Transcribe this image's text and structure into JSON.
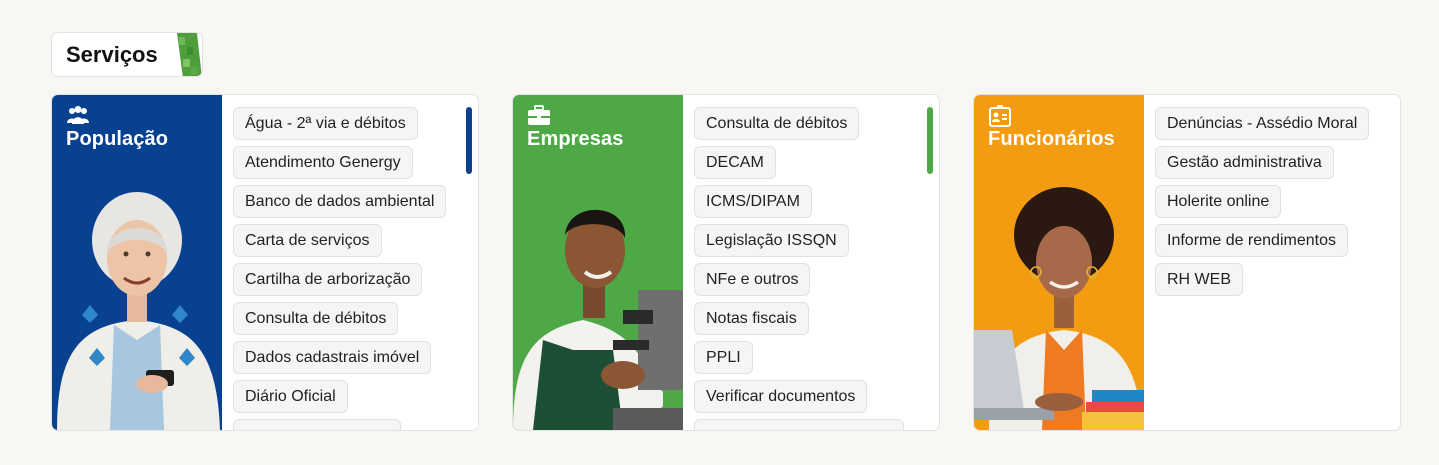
{
  "section": {
    "title": "Serviços"
  },
  "colors": {
    "populacao": "#07418f",
    "empresas": "#4ea846",
    "funcionarios": "#f39c11"
  },
  "cards": [
    {
      "key": "populacao",
      "title": "População",
      "icon": "people-icon",
      "items": [
        "Água - 2ª via e débitos",
        "Atendimento Genergy",
        "Banco de dados ambiental",
        "Carta de serviços",
        "Cartilha de arborização",
        "Consulta de débitos",
        "Dados cadastrais imóvel",
        "Diário Oficial"
      ]
    },
    {
      "key": "empresas",
      "title": "Empresas",
      "icon": "briefcase-icon",
      "items": [
        "Consulta de débitos",
        "DECAM",
        "ICMS/DIPAM",
        "Legislação ISSQN",
        "NFe e outros",
        "Notas fiscais",
        "PPLI",
        "Verificar documentos"
      ]
    },
    {
      "key": "funcionarios",
      "title": "Funcionários",
      "icon": "id-badge-icon",
      "items": [
        "Denúncias - Assédio Moral",
        "Gestão administrativa",
        "Holerite online",
        "Informe de rendimentos",
        "RH WEB"
      ]
    }
  ]
}
